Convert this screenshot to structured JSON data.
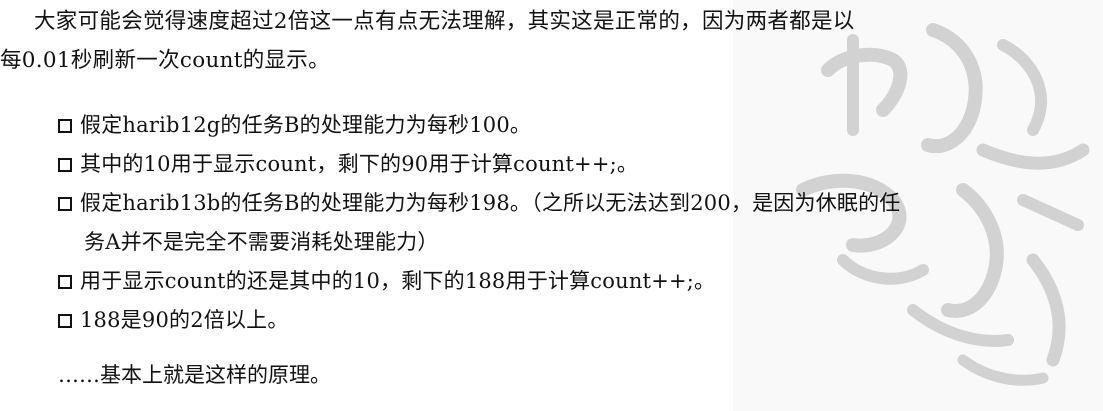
{
  "paragraph": {
    "line1": "大家可能会觉得速度超过2倍这一点有点无法理解，其实这是正常的，因为两者都是以",
    "line2": "每0.01秒刷新一次count的显示。"
  },
  "bullets": [
    {
      "text": "假定harib12g的任务B的处理能力为每秒100。"
    },
    {
      "text": "其中的10用于显示count，剩下的90用于计算count++;。"
    },
    {
      "text": "假定harib13b的任务B的处理能力为每秒198。（之所以无法达到200，是因为休眠的任",
      "continuation": "务A并不是完全不需要消耗处理能力）"
    },
    {
      "text": "用于显示count的还是其中的10，剩下的188用于计算count++;。"
    },
    {
      "text": "188是90的2倍以上。"
    }
  ],
  "closing": "……基本上就是这样的原理。",
  "colors": {
    "text": "#111111",
    "watermark": "#d9d9d9"
  },
  "icons": {
    "bullet": "checkbox-icon",
    "watermark": "seal-watermark"
  }
}
